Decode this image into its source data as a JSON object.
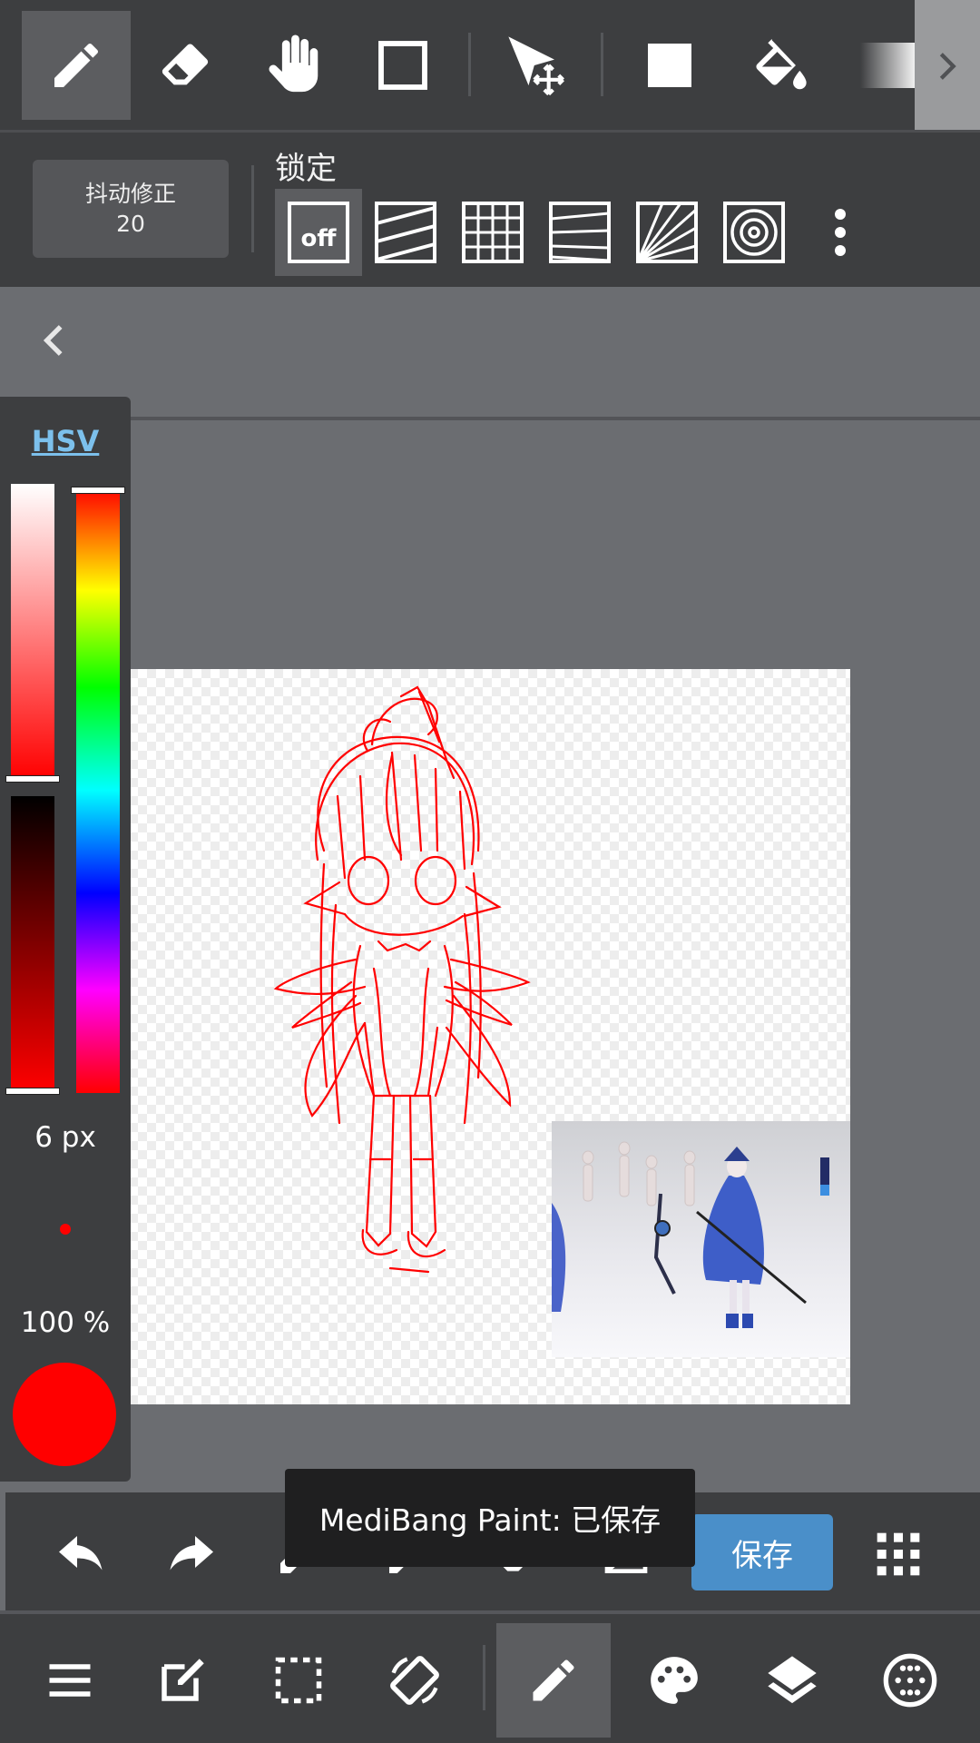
{
  "toolbar": {
    "tools": [
      {
        "icon": "pen-icon",
        "active": true
      },
      {
        "icon": "eraser-icon"
      },
      {
        "icon": "hand-icon"
      },
      {
        "icon": "rectangle-outline-icon"
      },
      {
        "icon": "move-select-icon"
      },
      {
        "icon": "fill-rectangle-icon"
      },
      {
        "icon": "bucket-icon"
      },
      {
        "icon": "gradient-icon"
      }
    ],
    "more_icon": "chevron-right-icon"
  },
  "subbar": {
    "stabilizer_label": "抖动修正",
    "stabilizer_value": "20",
    "lock_label": "锁定",
    "ruler_off_label": "off",
    "rulers": [
      "ruler-off-icon",
      "parallel-ruler-icon",
      "grid-ruler-icon",
      "perspective-ruler-icon",
      "radial-ruler-icon",
      "concentric-ruler-icon"
    ]
  },
  "color_panel": {
    "mode_label": "HSV",
    "brush_size": "6 px",
    "opacity": "100 %",
    "current_color": "#ff0000",
    "saturation": 1.0,
    "value": 1.0,
    "hue": 0
  },
  "canvas": {
    "stroke_color": "#ff0000"
  },
  "actionbar": {
    "save_label": "保存",
    "buttons": [
      "undo-icon",
      "redo-icon",
      "eyedropper-icon",
      "pen-icon",
      "eraser-icon",
      "clear-layer-icon",
      "save-button",
      "grid-menu-icon"
    ]
  },
  "toast": {
    "message": "MediBang Paint: 已保存"
  },
  "navbar": {
    "items": [
      "menu-icon",
      "edit-icon",
      "selection-icon",
      "rotate-canvas-icon",
      "brush-icon",
      "palette-icon",
      "layers-icon",
      "materials-icon"
    ],
    "active_index": 4
  }
}
